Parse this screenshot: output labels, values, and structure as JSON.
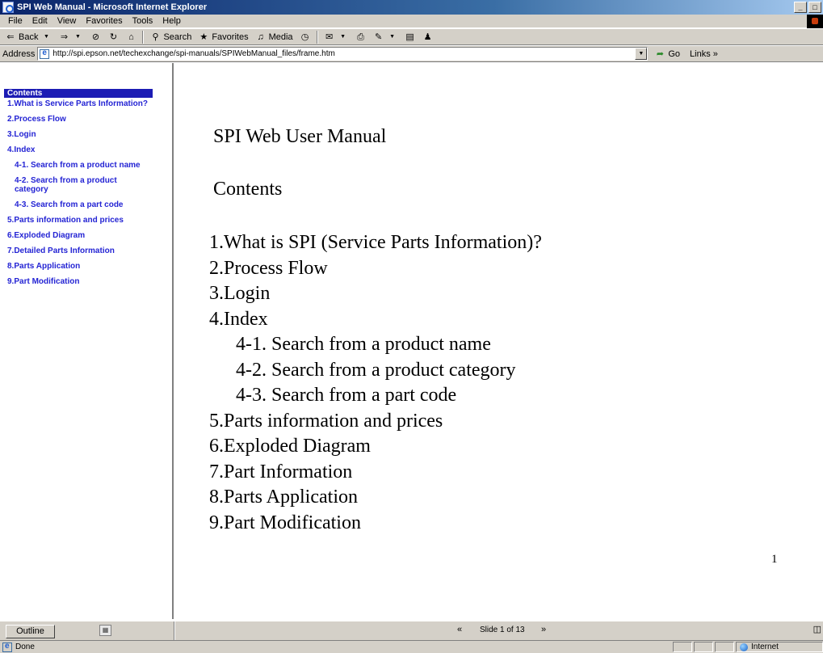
{
  "window": {
    "title": "SPI Web Manual - Microsoft Internet Explorer",
    "minimize": "_",
    "maximize": "□"
  },
  "menu": [
    "File",
    "Edit",
    "View",
    "Favorites",
    "Tools",
    "Help"
  ],
  "toolbar": {
    "back": "Back",
    "search": "Search",
    "favorites": "Favorites",
    "media": "Media"
  },
  "address": {
    "label": "Address",
    "url": "http://spi.epson.net/techexchange/spi-manuals/SPIWebManual_files/frame.htm",
    "go": "Go",
    "links": "Links »"
  },
  "nav": {
    "header": "Contents",
    "items": [
      {
        "label": "1.What is Service Parts Information?",
        "sub": false
      },
      {
        "label": "2.Process Flow",
        "sub": false
      },
      {
        "label": "3.Login",
        "sub": false
      },
      {
        "label": "4.Index",
        "sub": false
      },
      {
        "label": "4-1. Search from a product name",
        "sub": true
      },
      {
        "label": "4-2. Search from a product category",
        "sub": true
      },
      {
        "label": "4-3. Search from a part code",
        "sub": true
      },
      {
        "label": "5.Parts information and prices",
        "sub": false
      },
      {
        "label": "6.Exploded Diagram",
        "sub": false
      },
      {
        "label": "7.Detailed Parts Information",
        "sub": false
      },
      {
        "label": "8.Parts Application",
        "sub": false
      },
      {
        "label": "9.Part Modification",
        "sub": false
      }
    ]
  },
  "slide": {
    "title": "SPI Web User Manual",
    "subtitle": "Contents",
    "toc": [
      {
        "label": "1.What is SPI (Service Parts Information)?",
        "sub": false
      },
      {
        "label": "2.Process Flow",
        "sub": false
      },
      {
        "label": "3.Login",
        "sub": false
      },
      {
        "label": "4.Index",
        "sub": false
      },
      {
        "label": "4-1. Search from a product name",
        "sub": true
      },
      {
        "label": "4-2. Search from a product category",
        "sub": true
      },
      {
        "label": "4-3. Search from a part code",
        "sub": true
      },
      {
        "label": "5.Parts information and prices",
        "sub": false
      },
      {
        "label": "6.Exploded Diagram",
        "sub": false
      },
      {
        "label": "7.Part Information",
        "sub": false
      },
      {
        "label": "8.Parts Application",
        "sub": false
      },
      {
        "label": "9.Part Modification",
        "sub": false
      }
    ],
    "page_number": "1"
  },
  "slide_nav": {
    "outline": "Outline",
    "prev": "«",
    "label": "Slide 1 of 13",
    "next": "»"
  },
  "status": {
    "text": "Done",
    "zone": "Internet"
  }
}
